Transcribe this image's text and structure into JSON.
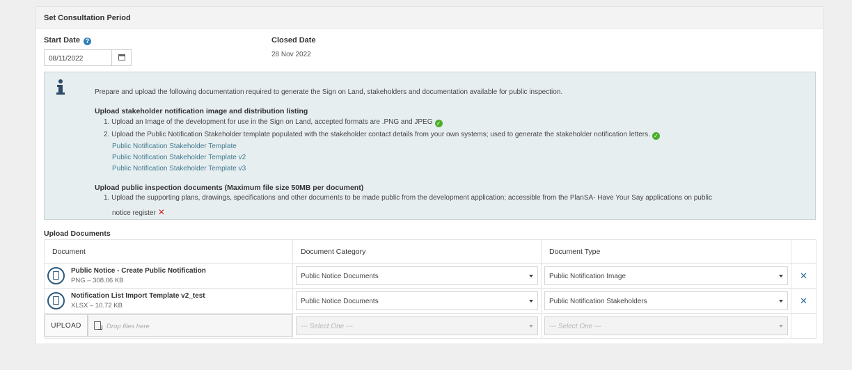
{
  "panel": {
    "title": "Set Consultation Period"
  },
  "start_date": {
    "label": "Start Date",
    "value": "08/11/2022"
  },
  "closed_date": {
    "label": "Closed Date",
    "value": "28 Nov 2022"
  },
  "info": {
    "intro": "Prepare and upload the following documentation required to generate the Sign on Land, stakeholders and documentation available for public inspection.",
    "section1_title": "Upload stakeholder notification image and distribution listing",
    "step1": "1. Upload an Image of the development for use in the Sign on Land, accepted formats are .PNG and JPEG",
    "step2": "2. Upload the Public Notification Stakeholder template populated with the stakeholder contact details from your own systems; used to generate the stakeholder notification letters.",
    "links": [
      "Public Notification Stakeholder Template",
      "Public Notification Stakeholder Template v2",
      "Public Notification Stakeholder Template v3"
    ],
    "section2_title": "Upload public inspection documents (Maximum file size 50MB per document)",
    "step3_line1": "1. Upload the supporting plans, drawings, specifications and other documents to be made public from the development application; accessible from the PlanSA- Have Your Say applications on public",
    "step3_line2": "notice register",
    "status_ok_color": "#4caf2a",
    "status_error_color": "#d32525"
  },
  "documents": {
    "title": "Upload Documents",
    "columns": [
      "Document",
      "Document Category",
      "Document Type"
    ],
    "rows": [
      {
        "name": "Public Notice - Create Public Notification",
        "meta": "PNG – 308.06 KB",
        "category": "Public Notice Documents",
        "type": "Public Notification Image"
      },
      {
        "name": "Notification List Import Template v2_test",
        "meta": "XLSX – 10.72 KB",
        "category": "Public Notice Documents",
        "type": "Public Notification Stakeholders"
      }
    ],
    "upload_label": "UPLOAD",
    "drop_placeholder": "Drop files here",
    "select_placeholder": "--- Select One ---"
  }
}
